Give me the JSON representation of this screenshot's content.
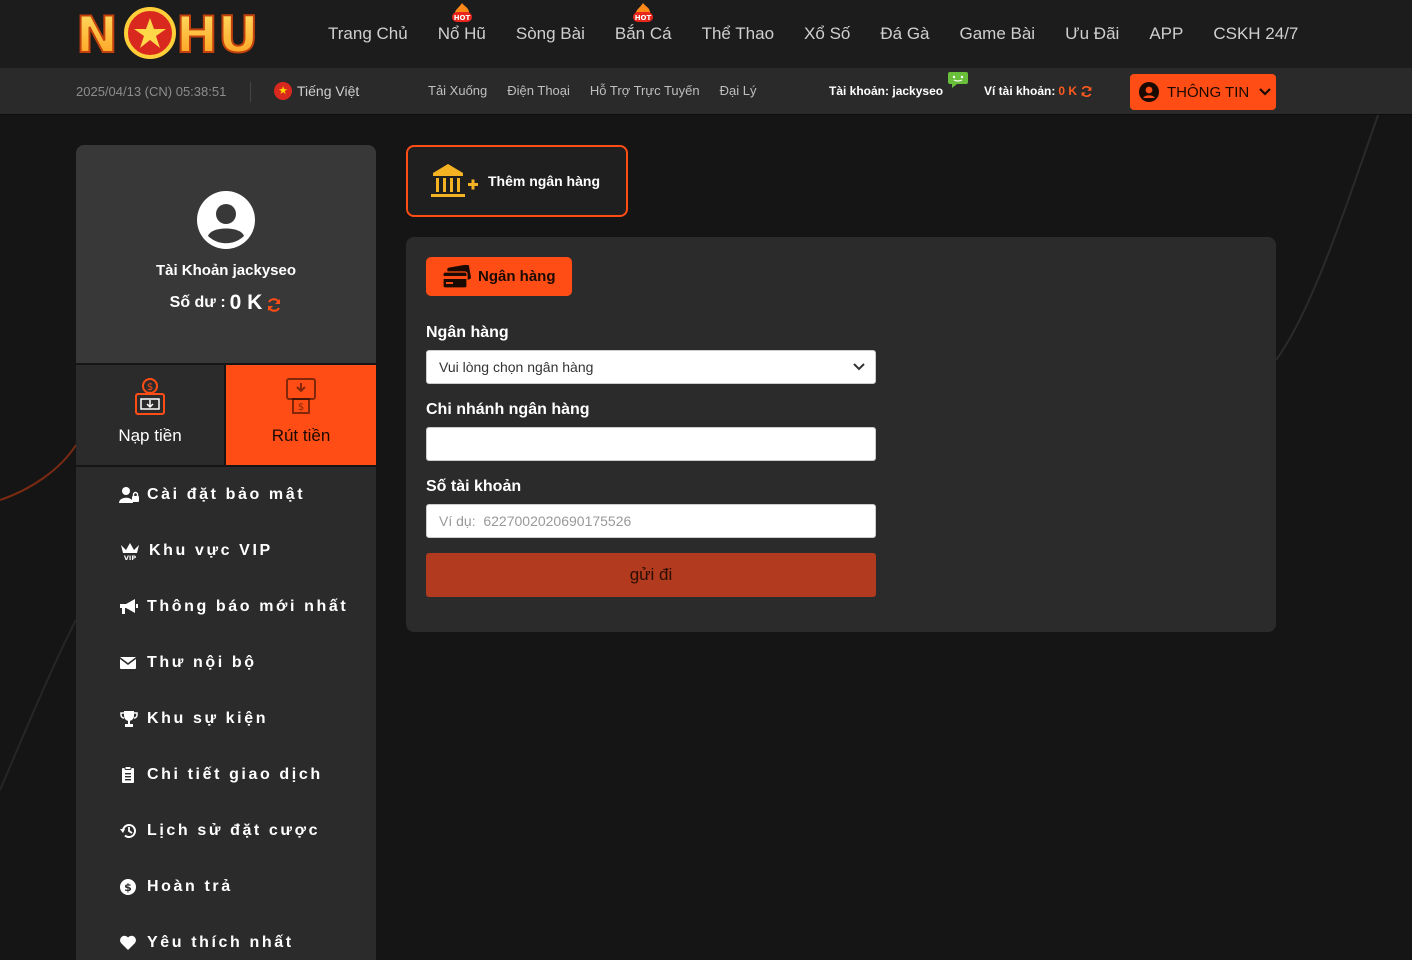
{
  "logo": {
    "text": "NOHU"
  },
  "nav": {
    "items": [
      {
        "label": "Trang Chủ",
        "hot": false
      },
      {
        "label": "Nổ Hũ",
        "hot": true
      },
      {
        "label": "Sòng Bài",
        "hot": false
      },
      {
        "label": "Bắn Cá",
        "hot": true
      },
      {
        "label": "Thể Thao",
        "hot": false
      },
      {
        "label": "Xổ Số",
        "hot": false
      },
      {
        "label": "Đá Gà",
        "hot": false
      },
      {
        "label": "Game Bài",
        "hot": false
      },
      {
        "label": "Ưu Đãi",
        "hot": false
      },
      {
        "label": "APP",
        "hot": false
      },
      {
        "label": "CSKH 24/7",
        "hot": false
      }
    ],
    "hot_badge": "HOT"
  },
  "subbar": {
    "datetime": "2025/04/13 (CN) 05:38:51",
    "language": "Tiếng Việt",
    "links": [
      "Tải Xuống",
      "Điện Thoại",
      "Hỗ Trợ Trực Tuyến",
      "Đại Lý"
    ],
    "account_label": "Tài khoản:",
    "account_name": "jackyseo",
    "wallet_label": "Ví tài khoản:",
    "wallet_amount": "0 K",
    "info_button": "THÔNG TIN"
  },
  "profile": {
    "account_title": "Tài Khoản jackyseo",
    "balance_label": "Số dư :",
    "balance_value": "0 K"
  },
  "tiles": {
    "deposit": "Nạp tiền",
    "withdraw": "Rút tiền"
  },
  "menu": [
    {
      "label": "Cài đặt bảo mật",
      "icon": "user-lock-icon"
    },
    {
      "label": "Khu vực VIP",
      "icon": "vip-crown-icon"
    },
    {
      "label": "Thông báo mới nhất",
      "icon": "megaphone-icon"
    },
    {
      "label": "Thư nội bộ",
      "icon": "envelope-icon"
    },
    {
      "label": "Khu sự kiện",
      "icon": "trophy-icon"
    },
    {
      "label": "Chi tiết giao dịch",
      "icon": "clipboard-icon"
    },
    {
      "label": "Lịch sử đặt cược",
      "icon": "history-icon"
    },
    {
      "label": "Hoàn trả",
      "icon": "dollar-circle-icon"
    },
    {
      "label": "Yêu thích nhất",
      "icon": "heart-icon"
    }
  ],
  "main": {
    "add_bank": "Thêm ngân hàng",
    "tab": "Ngân hàng",
    "bank_label": "Ngân hàng",
    "bank_select_placeholder": "Vui lòng chọn ngân hàng",
    "branch_label": "Chi nhánh ngân hàng",
    "branch_value": "",
    "account_number_label": "Số tài khoản",
    "account_number_placeholder": "Ví dụ:  6227002020690175526",
    "submit": "gửi đi"
  },
  "colors": {
    "accent": "#ff4d15",
    "background": "#151515",
    "panel": "#2b2b2b",
    "submit": "#b23a1e"
  }
}
